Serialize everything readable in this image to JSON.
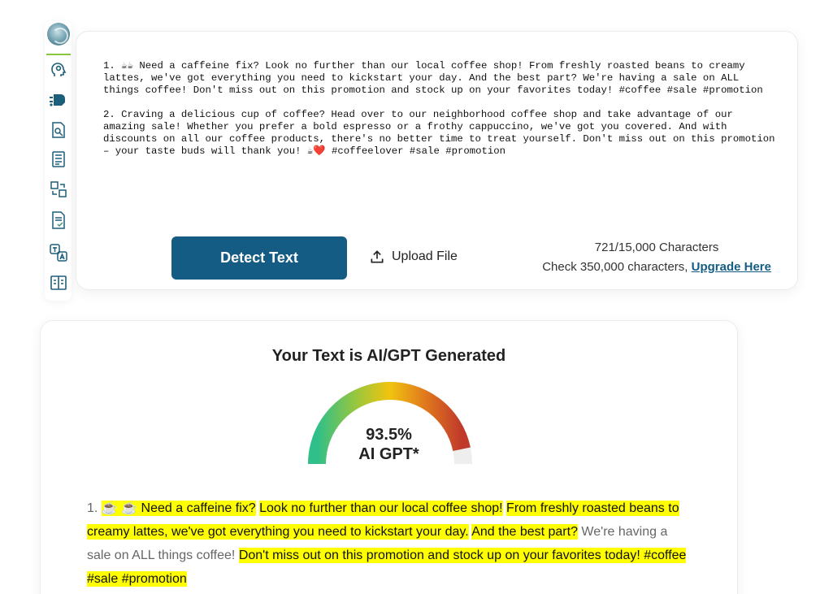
{
  "rail": {
    "items": [
      {
        "icon": "brain-logo-icon"
      },
      {
        "icon": "ai-head-icon"
      },
      {
        "icon": "ai-chip-icon"
      },
      {
        "icon": "document-search-icon"
      },
      {
        "icon": "document-list-icon"
      },
      {
        "icon": "rewrite-tool-icon"
      },
      {
        "icon": "document-check-icon"
      },
      {
        "icon": "translate-icon"
      },
      {
        "icon": "compare-icon"
      }
    ]
  },
  "input": {
    "text": "1. ☕☕ Need a caffeine fix? Look no further than our local coffee shop! From freshly roasted beans to creamy\nlattes, we've got everything you need to kickstart your day. And the best part? We're having a sale on ALL\nthings coffee! Don't miss out on this promotion and stock up on your favorites today! #coffee #sale #promotion\n\n2. Craving a delicious cup of coffee? Head over to our neighborhood coffee shop and take advantage of our\namazing sale! Whether you prefer a bold espresso or a frothy cappuccino, we've got you covered. And with\ndiscounts on all our coffee products, there's no better time to treat yourself. Don't miss out on this promotion\n– your taste buds will thank you! ☕❤️ #coffeelover #sale #promotion",
    "detect_label": "Detect Text",
    "upload_label": "Upload File",
    "char_count": "721/15,000 Characters",
    "upgrade_prefix": "Check 350,000 characters, ",
    "upgrade_link": "Upgrade Here"
  },
  "result": {
    "title": "Your Text is AI/GPT Generated",
    "gauge_percent": "93.5%",
    "gauge_caption": "AI GPT*",
    "gauge_value": 0.935,
    "prefix": "1. ",
    "segments": [
      {
        "text": "☕ ☕ Need a caffeine fix?",
        "highlight": true
      },
      {
        "text": " ",
        "highlight": false
      },
      {
        "text": "Look no further than our local coffee shop!",
        "highlight": true
      },
      {
        "text": " ",
        "highlight": false
      },
      {
        "text": "From freshly roasted beans to creamy lattes, we've got everything you need to kickstart your day.",
        "highlight": true
      },
      {
        "text": " ",
        "highlight": false
      },
      {
        "text": "And the best part?",
        "highlight": true
      },
      {
        "text": " We're having a sale on ALL things coffee! ",
        "highlight": false
      },
      {
        "text": "Don't miss out on this promotion and stock up on your favorites today! #coffee #sale #promotion",
        "highlight": true
      }
    ]
  },
  "colors": {
    "primary": "#145c83",
    "highlight": "#ffff00",
    "accent_green": "#8cc63f"
  }
}
